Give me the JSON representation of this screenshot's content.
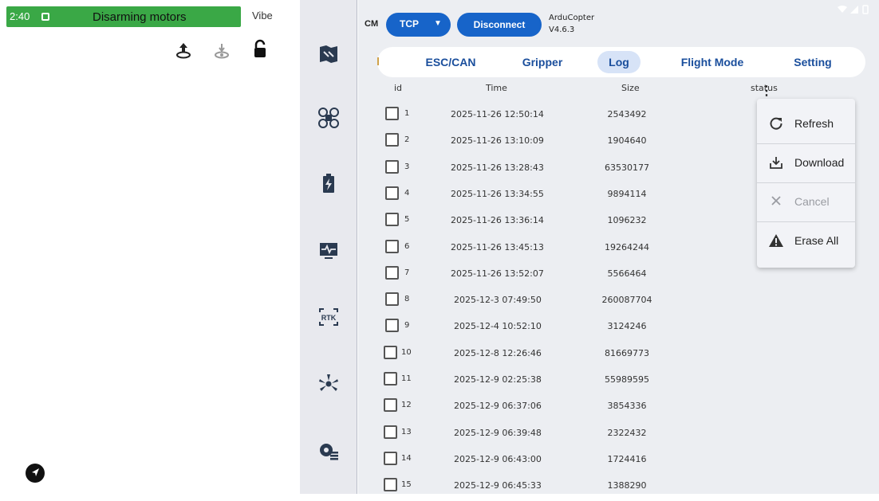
{
  "status_bar": {
    "clock": "2:40",
    "banner": "Disarming motors",
    "vibe": "Vibe"
  },
  "left_icons": [
    "upload-arrow-icon",
    "drone-ghost-icon",
    "unlock-icon",
    "navigate-icon"
  ],
  "sidebar": {
    "items": [
      "map-grid-icon",
      "drone-icon",
      "battery-icon",
      "monitor-pulse-icon",
      "rtk-icon",
      "propeller-icon",
      "settings-list-icon"
    ]
  },
  "connection": {
    "cm_label": "CM",
    "protocol": "TCP",
    "disconnect_label": "Disconnect",
    "firmware_name": "ArduCopter",
    "firmware_version": "V4.6.3"
  },
  "tabs": [
    {
      "label": "ESC/CAN",
      "active": false
    },
    {
      "label": "Gripper",
      "active": false
    },
    {
      "label": "Log",
      "active": true
    },
    {
      "label": "Flight Mode",
      "active": false
    },
    {
      "label": "Setting",
      "active": false
    }
  ],
  "table": {
    "headers": {
      "id": "id",
      "time": "Time",
      "size": "Size",
      "status": "status"
    },
    "rows": [
      {
        "id": "1",
        "time": "2025-11-26 12:50:14",
        "size": "2543492"
      },
      {
        "id": "2",
        "time": "2025-11-26 13:10:09",
        "size": "1904640"
      },
      {
        "id": "3",
        "time": "2025-11-26 13:28:43",
        "size": "63530177"
      },
      {
        "id": "4",
        "time": "2025-11-26 13:34:55",
        "size": "9894114"
      },
      {
        "id": "5",
        "time": "2025-11-26 13:36:14",
        "size": "1096232"
      },
      {
        "id": "6",
        "time": "2025-11-26 13:45:13",
        "size": "19264244"
      },
      {
        "id": "7",
        "time": "2025-11-26 13:52:07",
        "size": "5566464"
      },
      {
        "id": "8",
        "time": "2025-12-3 07:49:50",
        "size": "260087704"
      },
      {
        "id": "9",
        "time": "2025-12-4 10:52:10",
        "size": "3124246"
      },
      {
        "id": "10",
        "time": "2025-12-8 12:26:46",
        "size": "81669773"
      },
      {
        "id": "11",
        "time": "2025-12-9 02:25:38",
        "size": "55989595"
      },
      {
        "id": "12",
        "time": "2025-12-9 06:37:06",
        "size": "3854336"
      },
      {
        "id": "13",
        "time": "2025-12-9 06:39:48",
        "size": "2322432"
      },
      {
        "id": "14",
        "time": "2025-12-9 06:43:00",
        "size": "1724416"
      },
      {
        "id": "15",
        "time": "2025-12-9 06:45:33",
        "size": "1388290"
      }
    ]
  },
  "menu": {
    "items": [
      {
        "label": "Refresh",
        "icon": "refresh-icon",
        "enabled": true
      },
      {
        "label": "Download",
        "icon": "download-icon",
        "enabled": true
      },
      {
        "label": "Cancel",
        "icon": "close-icon",
        "enabled": false
      },
      {
        "label": "Erase All",
        "icon": "warning-icon",
        "enabled": true
      }
    ]
  },
  "colors": {
    "accent": "#1764c9",
    "banner_green": "#3aa846",
    "tab_text": "#1a4e9c"
  }
}
